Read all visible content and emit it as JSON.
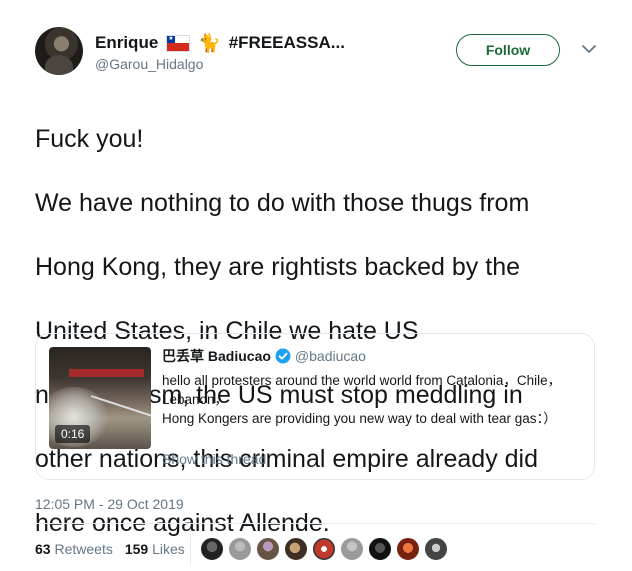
{
  "header": {
    "display_name": "Enrique",
    "hashtag": "#FREEASSA...",
    "handle": "@Garou_Hidalgo",
    "follow_label": "Follow"
  },
  "icons": [
    "chile-flag-icon",
    "cat-icon",
    "chevron-down-icon",
    "verified-badge-icon",
    "avatar"
  ],
  "tweet": {
    "lines": [
      "Fuck you!",
      "We have nothing to do with those thugs from",
      "Hong Kong, they are rightists backed by the",
      "United States, in Chile we hate US",
      "neoliberalism, the US must stop meddling in",
      "other nations, this criminal empire already did",
      "here once against Allende."
    ]
  },
  "quote": {
    "name": "巴丢草 Badiucao",
    "handle": "@badiucao",
    "duration": "0:16",
    "lines": [
      "hello all protesters around the world world from Catalonia，Chile，",
      "Lebanon，",
      "Hong Kongers are providing you new way to deal with tear gas：）"
    ],
    "show_thread": "Show this thread"
  },
  "timestamp": "12:05 PM - 29 Oct 2019",
  "stats": {
    "retweets_count": "63",
    "retweets_label": "Retweets",
    "likes_count": "159",
    "likes_label": "Likes"
  },
  "colors": {
    "follow_border": "#1b6b3a",
    "muted": "#657786",
    "verified": "#1da1f2"
  }
}
